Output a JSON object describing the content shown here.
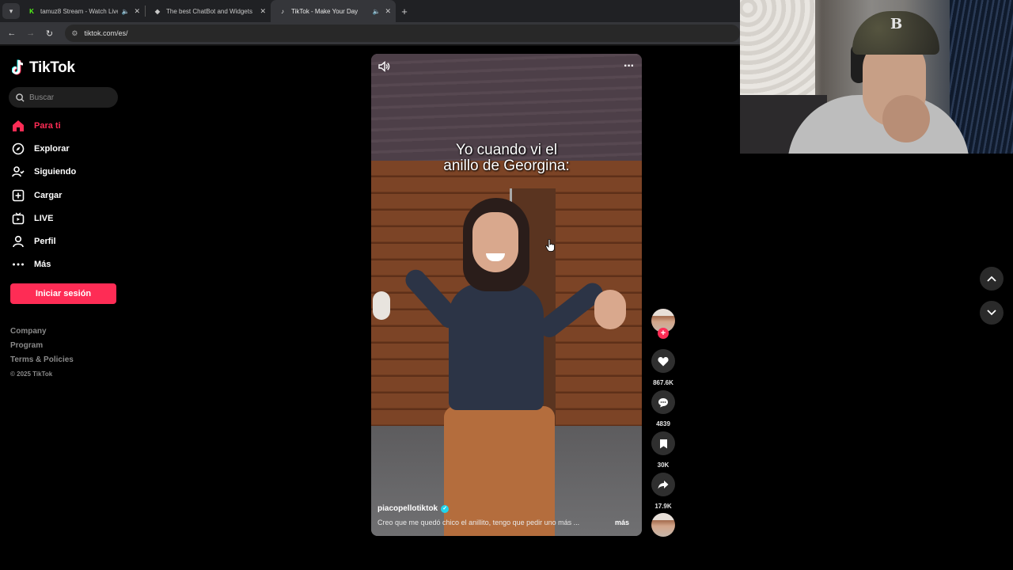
{
  "browser": {
    "tabs": [
      {
        "title": "tamuz8 Stream - Watch Live",
        "favicon": "kick-icon",
        "color": "#53fc18",
        "audio": true,
        "active": false
      },
      {
        "title": "The best ChatBot and Widgets",
        "favicon": "diamond-icon",
        "color": "#ffffff",
        "audio": false,
        "active": false
      },
      {
        "title": "TikTok - Make Your Day",
        "favicon": "tiktok-icon",
        "color": "#ffffff",
        "audio": true,
        "active": true
      }
    ],
    "url": "tiktok.com/es/"
  },
  "sidebar": {
    "logo": "TikTok",
    "search_placeholder": "Buscar",
    "nav": [
      {
        "label": "Para ti",
        "icon": "home-icon",
        "active": true
      },
      {
        "label": "Explorar",
        "icon": "compass-icon",
        "active": false
      },
      {
        "label": "Siguiendo",
        "icon": "following-icon",
        "active": false
      },
      {
        "label": "Cargar",
        "icon": "upload-icon",
        "active": false
      },
      {
        "label": "LIVE",
        "icon": "live-icon",
        "active": false
      },
      {
        "label": "Perfil",
        "icon": "profile-icon",
        "active": false
      },
      {
        "label": "Más",
        "icon": "more-icon",
        "active": false
      }
    ],
    "login_label": "Iniciar sesión",
    "footer": [
      "Company",
      "Program",
      "Terms & Policies"
    ],
    "copyright": "© 2025 TikTok"
  },
  "video": {
    "caption_line1": "Yo cuando vi el",
    "caption_line2": "anillo de Georgina:",
    "username": "piacopellotiktok",
    "description": "Creo que me quedó chico el anillito, tengo que pedir uno más ...",
    "more_label": "más"
  },
  "actions": {
    "likes": "867.6K",
    "comments": "4839",
    "saves": "30K",
    "shares": "17.9K"
  },
  "colors": {
    "accent": "#fe2c55",
    "verified": "#20d5ec"
  }
}
